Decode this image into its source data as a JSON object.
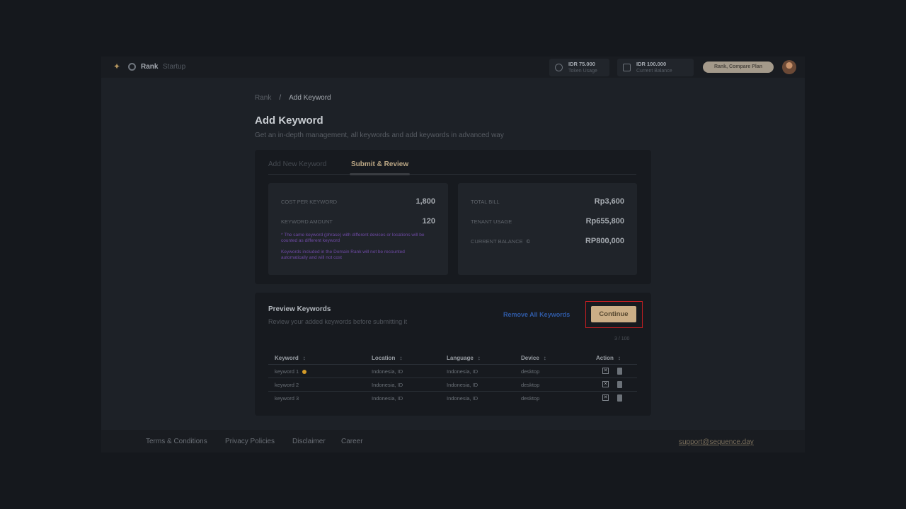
{
  "topbar": {
    "brand": "Rank",
    "brand_sub": "Startup",
    "stat1": {
      "value": "IDR 75.000",
      "label": "Token Usage"
    },
    "stat2": {
      "value": "IDR 100.000",
      "label": "Current Balance"
    },
    "upgrade_label": "Rank, Compare Plan"
  },
  "breadcrumb": {
    "root": "Rank",
    "separator": "/",
    "current": "Add Keyword"
  },
  "page": {
    "title": "Add Keyword",
    "subtitle": "Get an in-depth management, all keywords and add keywords in advanced way"
  },
  "tabs": [
    "Add New Keyword",
    "Submit & Review"
  ],
  "summary_left": {
    "rows": [
      {
        "label": "COST PER KEYWORD",
        "value": "1,800"
      },
      {
        "label": "KEYWORD AMOUNT",
        "value": "120"
      }
    ],
    "notes": [
      "* The same keyword (phrase) with different devices or locations will be counted as different keyword",
      "Keywords included in the Domain Rank will not be recounted automatically and will not cost"
    ]
  },
  "summary_right": {
    "rows": [
      {
        "label": "TOTAL BILL",
        "value": "Rp3,600"
      },
      {
        "label": "TENANT USAGE",
        "value": "Rp655,800"
      },
      {
        "label": "CURRENT BALANCE",
        "value": "RP800,000"
      }
    ],
    "currency_icon": "©"
  },
  "preview": {
    "title": "Preview Keywords",
    "subtitle": "Review your added keywords before submitting it",
    "remove_all_label": "Remove All Keywords",
    "continue_label": "Continue",
    "pager": "3 / 100",
    "columns": [
      "Keyword",
      "Location",
      "Language",
      "Device",
      "Action"
    ],
    "sort_icon": "↕",
    "rows": [
      {
        "keyword": "keyword 1",
        "location": "Indonesia, ID",
        "language": "Indonesia, ID",
        "device": "desktop"
      },
      {
        "keyword": "keyword 2",
        "location": "Indonesia, ID",
        "language": "Indonesia, ID",
        "device": "desktop"
      },
      {
        "keyword": "keyword 3",
        "location": "Indonesia, ID",
        "language": "Indonesia, ID",
        "device": "desktop"
      }
    ]
  },
  "footer": {
    "links": [
      "Terms & Conditions",
      "Privacy Policies",
      "Disclaimer",
      "Career"
    ],
    "email": "support@sequence.day"
  },
  "colors": {
    "accent": "#cbae86",
    "link_blue": "#2f5aa6",
    "highlight_red": "#c01e22",
    "dot_orange": "#d49b28",
    "note_purple": "#6f4aa6"
  }
}
